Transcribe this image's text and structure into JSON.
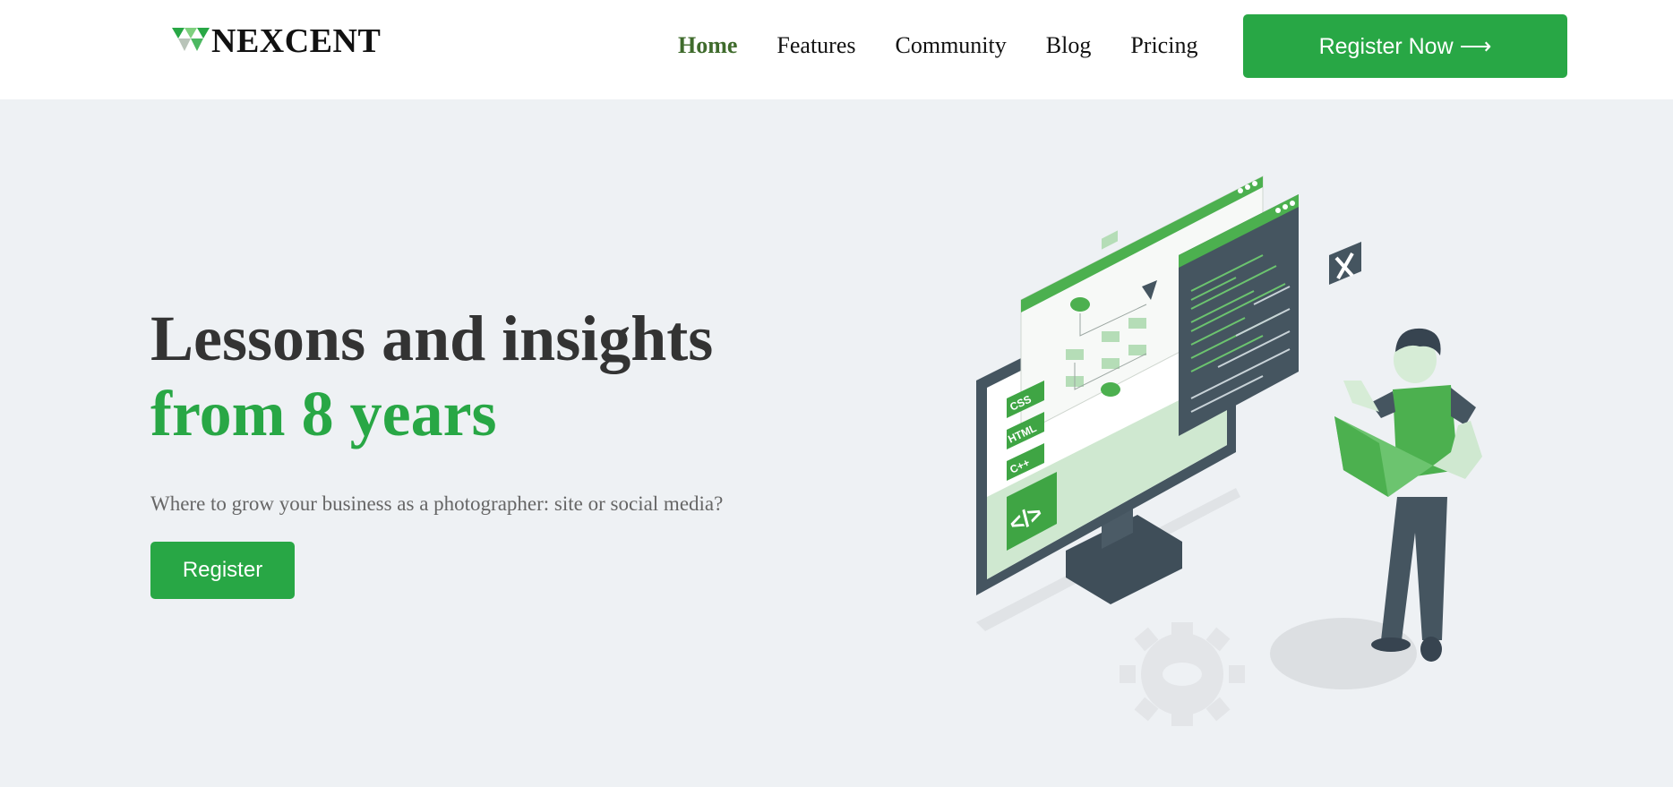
{
  "header": {
    "brand": "NEXCENT",
    "nav": [
      {
        "label": "Home",
        "active": true
      },
      {
        "label": "Features"
      },
      {
        "label": "Community"
      },
      {
        "label": "Blog"
      },
      {
        "label": "Pricing"
      }
    ],
    "cta_label": "Register Now ⟶"
  },
  "hero": {
    "title_line1": "Lessons and insights",
    "title_line2": "from 8 years",
    "subtitle": "Where to grow your business as a photographer: site or social media?",
    "button_label": "Register"
  },
  "illustration": {
    "tags": [
      "CSS",
      "HTML",
      "C++"
    ],
    "code_badge": "</>"
  },
  "colors": {
    "accent": "#28a745",
    "nav_active": "#3f6b2c",
    "page_bg": "#eef1f4",
    "dark": "#455560"
  },
  "icons": [
    "logo-mark-icon",
    "gear-icon",
    "code-icon",
    "close-icon"
  ]
}
